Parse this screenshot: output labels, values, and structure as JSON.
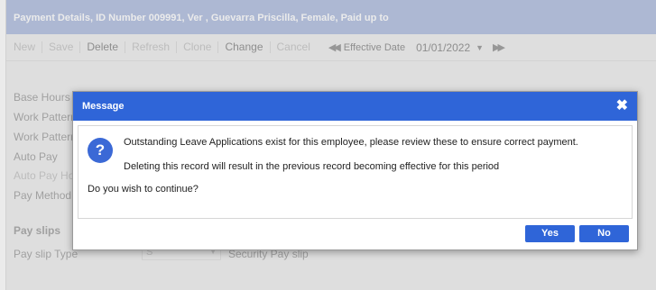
{
  "window": {
    "title": "Payment Details, ID Number 009991, Ver , Guevarra Priscilla, Female, Paid up to"
  },
  "toolbar": {
    "new": "New",
    "save": "Save",
    "delete": "Delete",
    "refresh": "Refresh",
    "clone": "Clone",
    "change": "Change",
    "cancel": "Cancel",
    "effective_date_label": "Effective Date",
    "effective_date_value": "01/01/2022"
  },
  "form": {
    "labels": [
      "Base Hours",
      "Work Patterns",
      "Work Pattern",
      "Auto Pay",
      "Auto Pay Ho",
      "Pay Method"
    ],
    "pay_slips_section": "Pay slips",
    "pay_slip_type_label": "Pay slip Type",
    "pay_slip_type_value": "S",
    "security_pay_slip": "Security Pay slip"
  },
  "dialog": {
    "title": "Message",
    "line1": "Outstanding Leave Applications exist for this employee, please review these to ensure correct payment.",
    "line2": "Deleting this record will result in the previous record becoming effective for this period",
    "question": "Do you wish to continue?",
    "yes_label": "Yes",
    "no_label": "No"
  }
}
